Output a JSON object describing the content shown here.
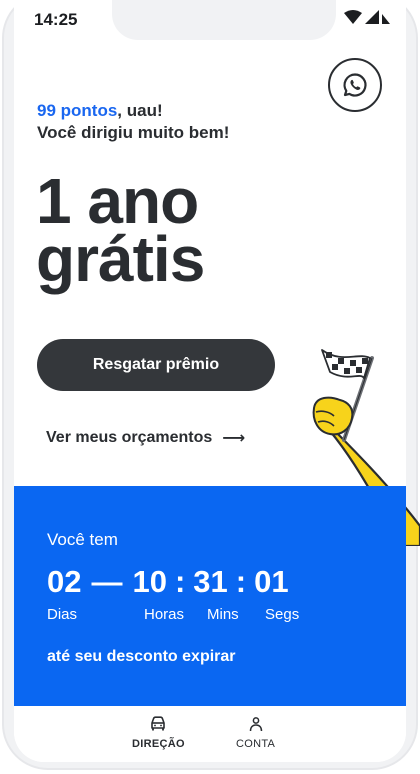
{
  "status_bar": {
    "time": "14:25"
  },
  "header": {
    "whatsapp_icon": "whatsapp-icon"
  },
  "score": {
    "points": "99 pontos",
    "suffix": ", uau!",
    "message": "Você dirigiu muito bem!"
  },
  "prize": {
    "line1": "1 ano",
    "line2": "grátis"
  },
  "actions": {
    "redeem_label": "Resgatar prêmio",
    "quotes_label": "Ver meus orçamentos",
    "quotes_arrow": "⟶"
  },
  "countdown": {
    "heading": "Você tem",
    "days": "02",
    "dash": "—",
    "hours": "10",
    "minutes": "31",
    "seconds": "01",
    "separator": ":",
    "labels": {
      "days": "Dias",
      "hours": "Horas",
      "minutes": "Mins",
      "seconds": "Segs"
    },
    "footer": "até seu desconto expirar"
  },
  "tab_bar": {
    "tabs": [
      {
        "label": "DIREÇÃO",
        "icon": "car-icon"
      },
      {
        "label": "CONTA",
        "icon": "user-icon"
      }
    ]
  },
  "colors": {
    "accent": "#0a67f2",
    "points": "#1a67f0",
    "button": "#34373b",
    "flag_hand": "#f7d31b"
  }
}
